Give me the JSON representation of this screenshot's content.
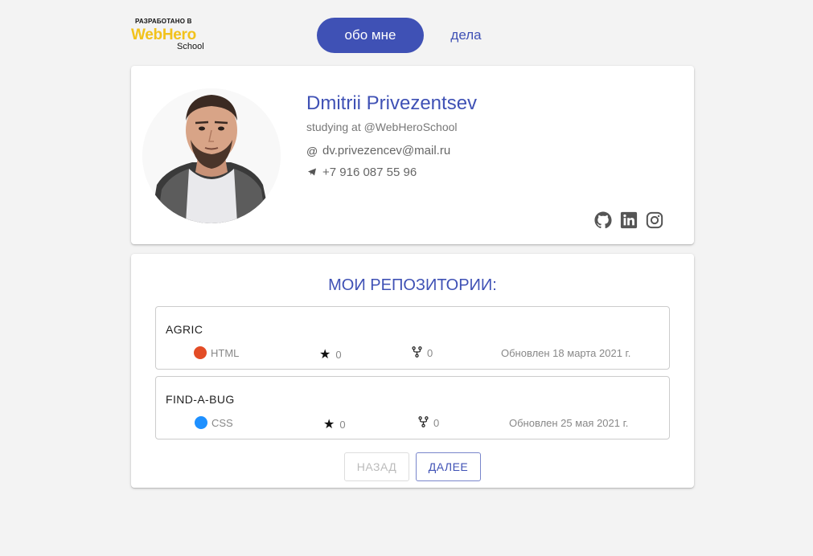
{
  "header": {
    "logo": {
      "line1": "РАЗРАБОТАНО В",
      "line2": "WebHero",
      "line3": "School"
    },
    "nav": [
      {
        "label": "обо мне",
        "active": true
      },
      {
        "label": "дела",
        "active": false
      }
    ]
  },
  "profile": {
    "name": "Dmitrii Privezentsev",
    "subtitle": "studying at @WebHeroSchool",
    "email": "dv.privezencev@mail.ru",
    "phone": "+7 916 087 55 96",
    "social": [
      "github-icon",
      "linkedin-icon",
      "instagram-icon"
    ]
  },
  "repositories": {
    "title": "МОИ РЕПОЗИТОРИИ:",
    "items": [
      {
        "name": "AGRIC",
        "language": "HTML",
        "language_color": "#e34c26",
        "stars": "0",
        "forks": "0",
        "updated": "Обновлен 18 марта 2021 г."
      },
      {
        "name": "FIND-A-BUG",
        "language": "CSS",
        "language_color": "#1e90ff",
        "stars": "0",
        "forks": "0",
        "updated": "Обновлен 25 мая 2021 г."
      }
    ],
    "pagination": {
      "back": "НАЗАД",
      "next": "ДАЛЕЕ"
    }
  },
  "colors": {
    "accent": "#3f51b5",
    "logo_yellow": "#f2c21b",
    "background": "#f3f3f3"
  }
}
